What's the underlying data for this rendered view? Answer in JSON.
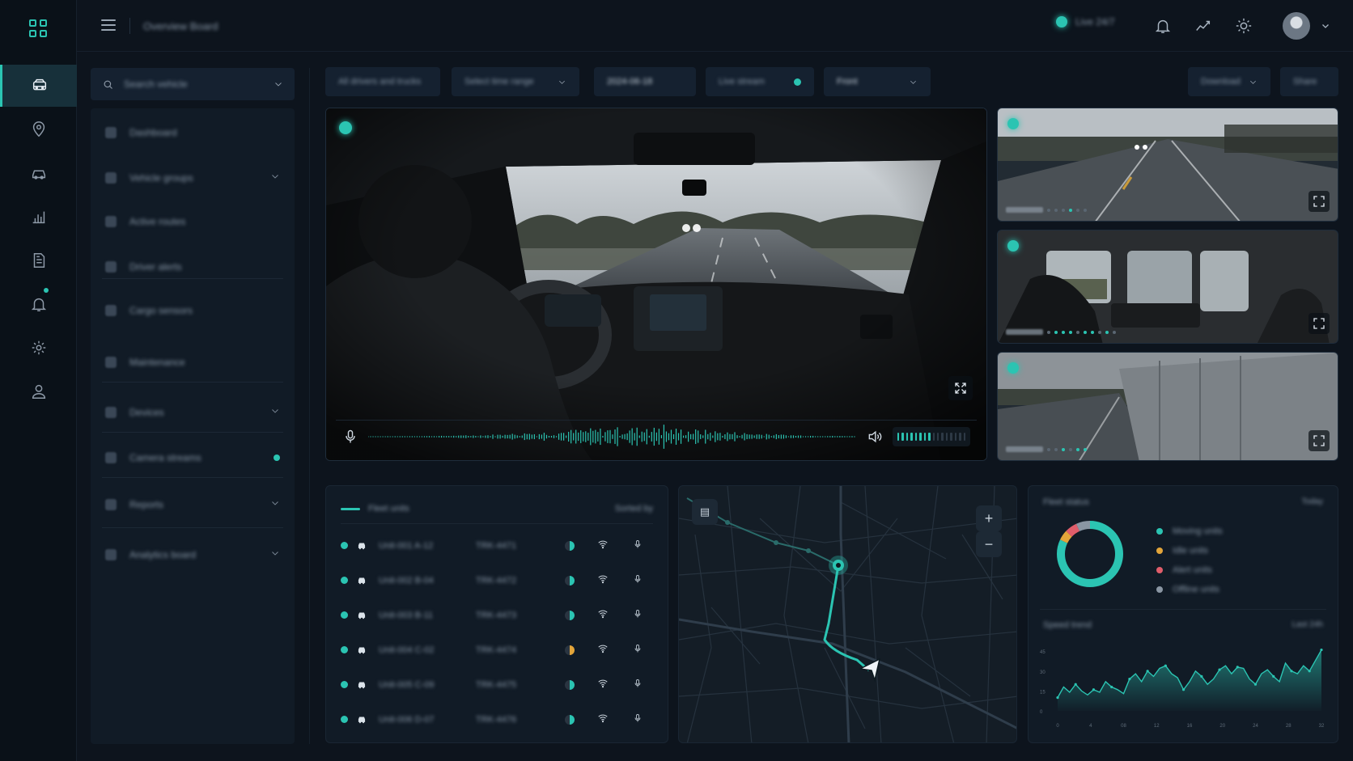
{
  "colors": {
    "accent": "#2bc4b2",
    "amber": "#e3a53a",
    "red": "#e05d6a",
    "grey": "#8a96a3",
    "background": "#0d141d"
  },
  "topbar": {
    "title": "Overview Board",
    "status_text": "Live 24/7"
  },
  "search": {
    "placeholder": "Search vehicle"
  },
  "sidebar": {
    "items": [
      {
        "label": "Dashboard",
        "icon": "layers-icon",
        "chevron": false
      },
      {
        "label": "Vehicle groups",
        "icon": "route-icon",
        "chevron": true
      },
      {
        "label": "Active routes",
        "icon": "route-icon",
        "chevron": false
      },
      {
        "label": "Driver alerts",
        "icon": "flag-icon",
        "chevron": false
      },
      {
        "label": "Cargo sensors",
        "icon": "sensor-icon",
        "chevron": false
      },
      {
        "label": "Maintenance",
        "icon": "wrench-icon",
        "chevron": false
      },
      {
        "label": "Devices",
        "icon": "device-icon",
        "chevron": true
      },
      {
        "label": "Camera streams",
        "icon": "camera-icon",
        "chevron": false,
        "indicator": true
      },
      {
        "label": "Reports",
        "icon": "clock-icon",
        "chevron": true
      },
      {
        "label": "Analytics board",
        "icon": "chart-icon",
        "chevron": true
      }
    ]
  },
  "filters": {
    "f1": "All drivers and trucks",
    "f2": "Select time range",
    "f3": "2024-06-18",
    "f4": "Live stream",
    "f5": "Front",
    "f6": "Download",
    "f7": "Share"
  },
  "vehicles": {
    "title": "Fleet units",
    "meta": "Sorted by",
    "rows": [
      {
        "name": "Unit-001 A-12",
        "id": "TRK-4471",
        "signal": "teal"
      },
      {
        "name": "Unit-002 B-04",
        "id": "TRK-4472",
        "signal": "teal"
      },
      {
        "name": "Unit-003 B-11",
        "id": "TRK-4473",
        "signal": "teal"
      },
      {
        "name": "Unit-004 C-02",
        "id": "TRK-4474",
        "signal": "amber"
      },
      {
        "name": "Unit-005 C-09",
        "id": "TRK-4475",
        "signal": "teal"
      },
      {
        "name": "Unit-006 D-07",
        "id": "TRK-4476",
        "signal": "teal"
      }
    ]
  },
  "stats": {
    "title": "Fleet status",
    "meta": "Today",
    "legend": [
      {
        "label": "Moving units",
        "color": "#2bc4b2"
      },
      {
        "label": "Idle units",
        "color": "#e3a53a"
      },
      {
        "label": "Alert units",
        "color": "#e05d6a"
      },
      {
        "label": "Offline units",
        "color": "#8a96a3"
      }
    ],
    "donut": [
      82,
      5,
      6,
      7
    ]
  },
  "trend": {
    "title": "Speed trend",
    "meta": "Last 24h"
  },
  "chart_data": {
    "type": "area",
    "yticks": [
      "0",
      "15",
      "30",
      "45"
    ],
    "xticks": [
      "0",
      "4",
      "08",
      "12",
      "16",
      "20",
      "24",
      "28",
      "32"
    ],
    "ylim": [
      0,
      50
    ],
    "x": [
      0,
      1,
      2,
      3,
      4,
      5,
      6,
      7,
      8,
      9,
      10,
      11,
      12,
      13,
      14,
      15,
      16,
      17,
      18,
      19,
      20,
      21,
      22,
      23,
      24,
      25,
      26,
      27,
      28,
      29,
      30,
      31,
      32,
      33,
      34,
      35,
      36,
      37,
      38,
      39,
      40,
      41,
      42,
      43,
      44
    ],
    "values": [
      10,
      18,
      14,
      20,
      15,
      12,
      16,
      14,
      22,
      18,
      16,
      13,
      24,
      28,
      22,
      30,
      26,
      32,
      34,
      28,
      25,
      16,
      22,
      30,
      26,
      20,
      24,
      31,
      34,
      28,
      33,
      32,
      24,
      20,
      28,
      31,
      26,
      22,
      36,
      30,
      28,
      34,
      30,
      38,
      46
    ]
  }
}
